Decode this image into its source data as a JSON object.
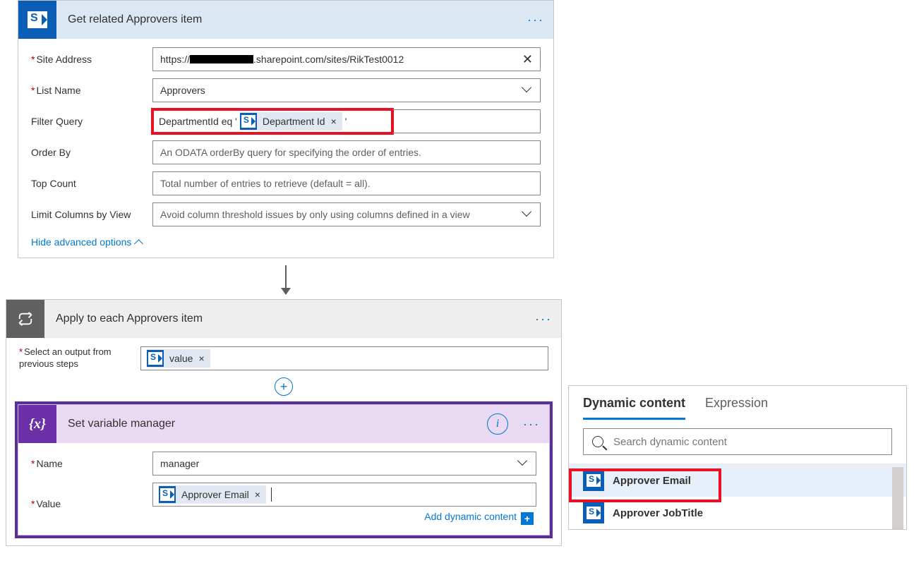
{
  "action1": {
    "title": "Get related Approvers item",
    "fields": {
      "site_address_label": "Site Address",
      "site_address_prefix": "https://",
      "site_address_suffix": ".sharepoint.com/sites/RikTest0012",
      "list_name_label": "List Name",
      "list_name_value": "Approvers",
      "filter_query_label": "Filter Query",
      "filter_query_text": "DepartmentId eq '",
      "filter_query_token": "Department Id",
      "order_by_label": "Order By",
      "order_by_placeholder": "An ODATA orderBy query for specifying the order of entries.",
      "top_count_label": "Top Count",
      "top_count_placeholder": "Total number of entries to retrieve (default = all).",
      "limit_view_label": "Limit Columns by View",
      "limit_view_placeholder": "Avoid column threshold issues by only using columns defined in a view"
    },
    "advanced_link": "Hide advanced options"
  },
  "action2": {
    "title": "Apply to each Approvers item",
    "select_label": "Select an output from previous steps",
    "select_token": "value"
  },
  "action3": {
    "title": "Set variable manager",
    "name_label": "Name",
    "name_value": "manager",
    "value_label": "Value",
    "value_token": "Approver Email",
    "add_content": "Add dynamic content"
  },
  "dynamic_panel": {
    "tab_dynamic": "Dynamic content",
    "tab_expression": "Expression",
    "search_placeholder": "Search dynamic content",
    "items": [
      "Approver Email",
      "Approver JobTitle"
    ]
  }
}
